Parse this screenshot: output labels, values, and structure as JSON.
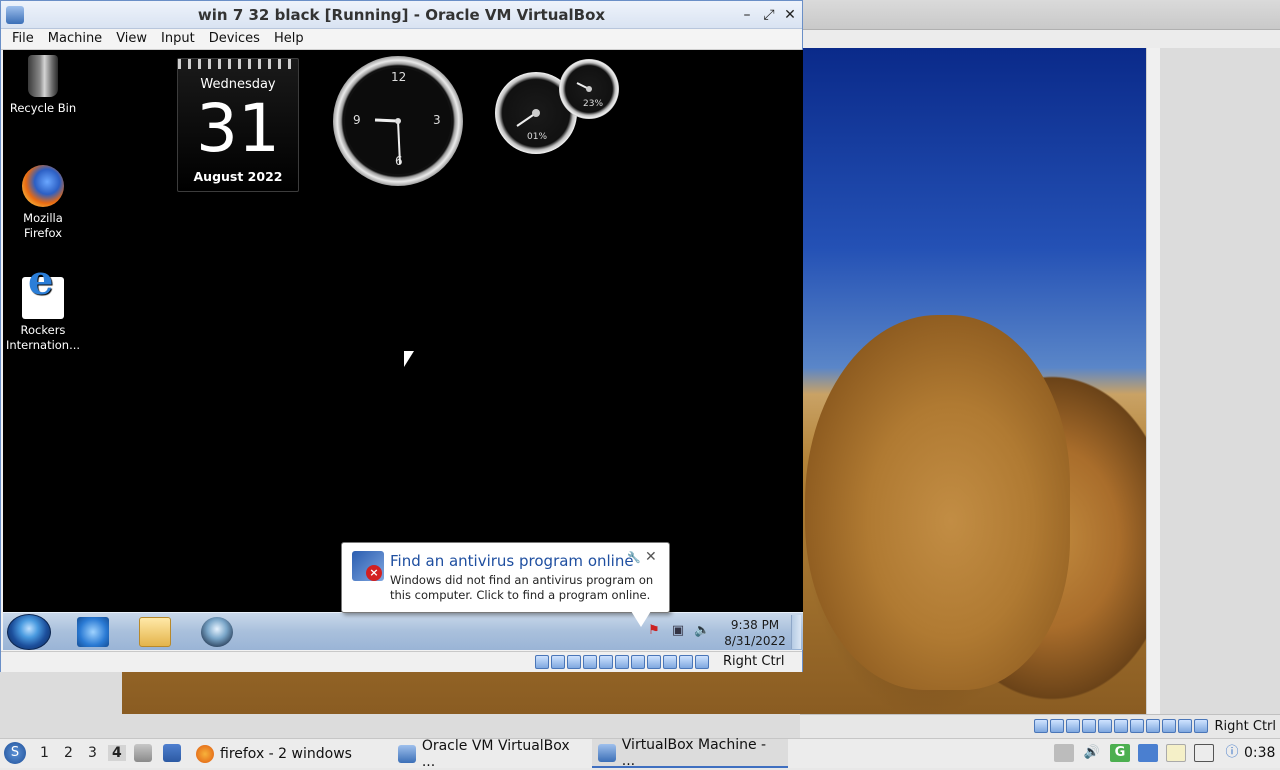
{
  "vbox": {
    "title": "win 7 32 black [Running] - Oracle VM VirtualBox",
    "menus": [
      "File",
      "Machine",
      "View",
      "Input",
      "Devices",
      "Help"
    ],
    "status_key": "Right Ctrl"
  },
  "host_window": {
    "status_key": "Right Ctrl"
  },
  "guest": {
    "desktop_icons": [
      {
        "label": "Recycle Bin",
        "icon": "recycle-bin-icon"
      },
      {
        "label": "Mozilla Firefox",
        "icon": "firefox-icon"
      },
      {
        "label": "Rockers Internation...",
        "icon": "internet-explorer-icon"
      }
    ],
    "calendar": {
      "weekday": "Wednesday",
      "day": "31",
      "month_year": "August 2022"
    },
    "clock": {
      "numerals": [
        "12",
        "3",
        "6",
        "9"
      ]
    },
    "meter": {
      "cpu": "01%",
      "memory": "23%"
    },
    "balloon": {
      "title": "Find an antivirus program online",
      "body": "Windows did not find an antivirus program on this computer. Click to find a program online."
    },
    "tray": {
      "time": "9:38 PM",
      "date": "8/31/2022"
    }
  },
  "panel": {
    "workspaces": [
      "1",
      "2",
      "3",
      "4"
    ],
    "active_workspace": "4",
    "tasks": [
      {
        "label": "firefox - 2 windows",
        "icon": "firefox-icon"
      },
      {
        "label": "Oracle VM VirtualBox ...",
        "icon": "virtualbox-icon"
      },
      {
        "label": "VirtualBox Machine - ...",
        "icon": "virtualbox-icon"
      }
    ],
    "clock": "0:38"
  },
  "colors": {
    "accent": "#3f6fc0",
    "balloon_title": "#1f4fa0"
  }
}
